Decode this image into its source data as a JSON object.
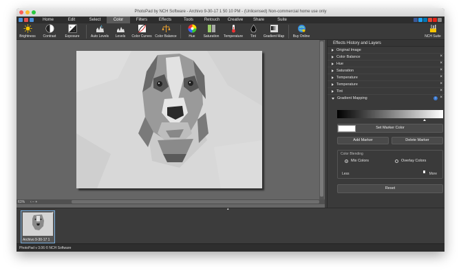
{
  "window": {
    "title": "PhotoPad by NCH Software - Archivo 9-30-17 1 50 10 PM - (Unlicensed) Non-commercial home use only"
  },
  "menu": {
    "tabs": [
      "Home",
      "Edit",
      "Select",
      "Color",
      "Filters",
      "Effects",
      "Tools",
      "Retouch",
      "Creative",
      "Share",
      "Suite"
    ],
    "active_tab": "Color"
  },
  "toolbar": {
    "tools": [
      {
        "label": "Brightness",
        "icon": "sun-icon"
      },
      {
        "label": "Contrast",
        "icon": "contrast-icon"
      },
      {
        "label": "Exposure",
        "icon": "exposure-icon"
      },
      {
        "label": "Auto Levels",
        "icon": "auto-levels-icon"
      },
      {
        "label": "Levels",
        "icon": "levels-icon"
      },
      {
        "label": "Color Curves",
        "icon": "color-curves-icon"
      },
      {
        "label": "Color Balance",
        "icon": "color-balance-icon"
      },
      {
        "label": "Hue",
        "icon": "hue-wheel-icon"
      },
      {
        "label": "Saturation",
        "icon": "saturation-icon"
      },
      {
        "label": "Temperature",
        "icon": "thermometer-icon"
      },
      {
        "label": "Tint",
        "icon": "tint-drop-icon"
      },
      {
        "label": "Gradient Map",
        "icon": "gradient-map-icon"
      },
      {
        "label": "Buy Online",
        "icon": "buy-online-icon"
      },
      {
        "label": "NCH Suite",
        "icon": "nch-suite-icon"
      }
    ]
  },
  "panel": {
    "header": "Effects History and Layers",
    "layers": [
      {
        "label": "Original Image",
        "closable": false
      },
      {
        "label": "Color Balance",
        "closable": true
      },
      {
        "label": "Hue",
        "closable": true
      },
      {
        "label": "Saturation",
        "closable": true
      },
      {
        "label": "Temperature",
        "closable": true
      },
      {
        "label": "Temperature",
        "closable": true
      },
      {
        "label": "Tint",
        "closable": true
      }
    ],
    "expanded_layer": "Gradient Mapping",
    "help_label": "?",
    "close_symbol": "×",
    "set_marker_color": "Set Marker Color",
    "add_marker": "Add Marker",
    "delete_marker": "Delete Marker",
    "color_blending_title": "Color Blending",
    "mix_colors": "Mix Colors",
    "overlay_colors": "Overlay Colors",
    "blend_selected": "Mix Colors",
    "less_label": "Less",
    "more_label": "More",
    "reset": "Reset"
  },
  "canvas": {
    "zoom": "61%",
    "zoom_controls": "‹ − +"
  },
  "filmstrip": {
    "thumbnail_caption": "Archivo 9-30-17 1",
    "collapse_glyph": "▴"
  },
  "statusbar": {
    "text": "PhotoPad v 3.06 © NCH Software"
  },
  "colors": {
    "background": "#3c3c3c",
    "canvas": "#666666",
    "active_tab": "#5a5a5a",
    "help_blue": "#3b7bd4"
  }
}
